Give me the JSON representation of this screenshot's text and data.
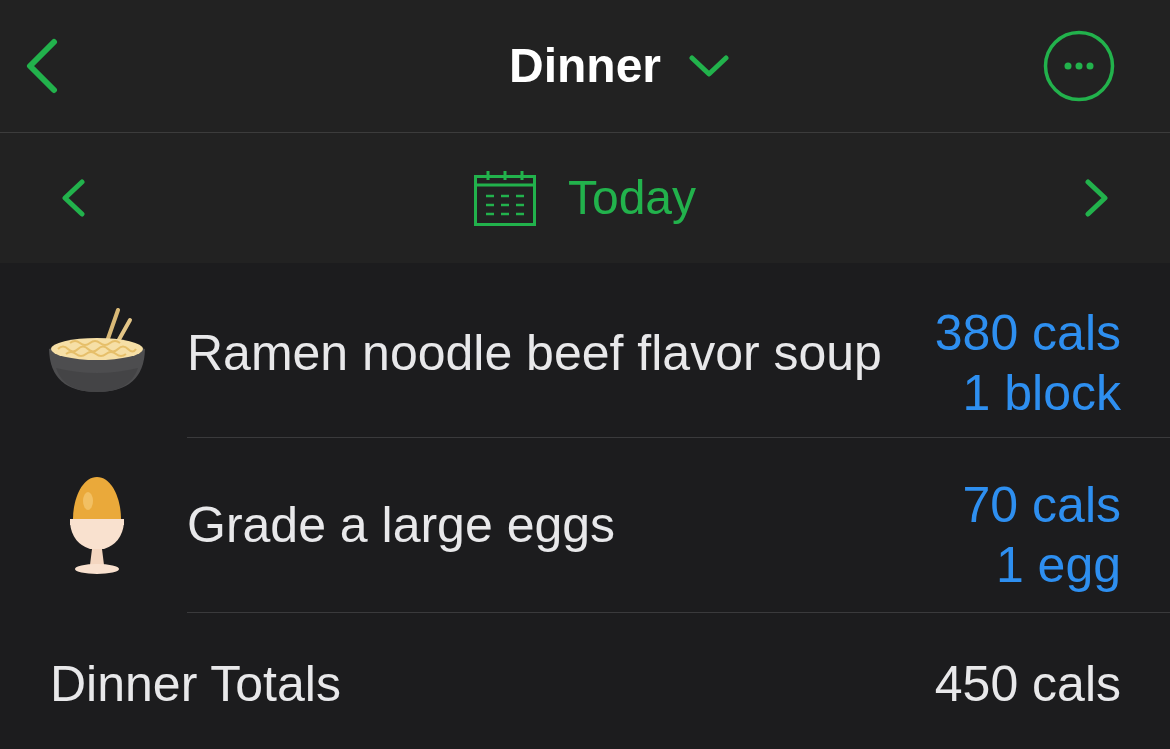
{
  "nav_bar": {
    "title": "Dinner"
  },
  "date_bar": {
    "label": "Today"
  },
  "food_items": [
    {
      "name": "Ramen noodle beef flavor soup",
      "calories": "380 cals",
      "serving": "1 block"
    },
    {
      "name": "Grade a large eggs",
      "calories": "70 cals",
      "serving": "1 egg"
    }
  ],
  "totals": {
    "label": "Dinner Totals",
    "calories": "450 cals"
  }
}
